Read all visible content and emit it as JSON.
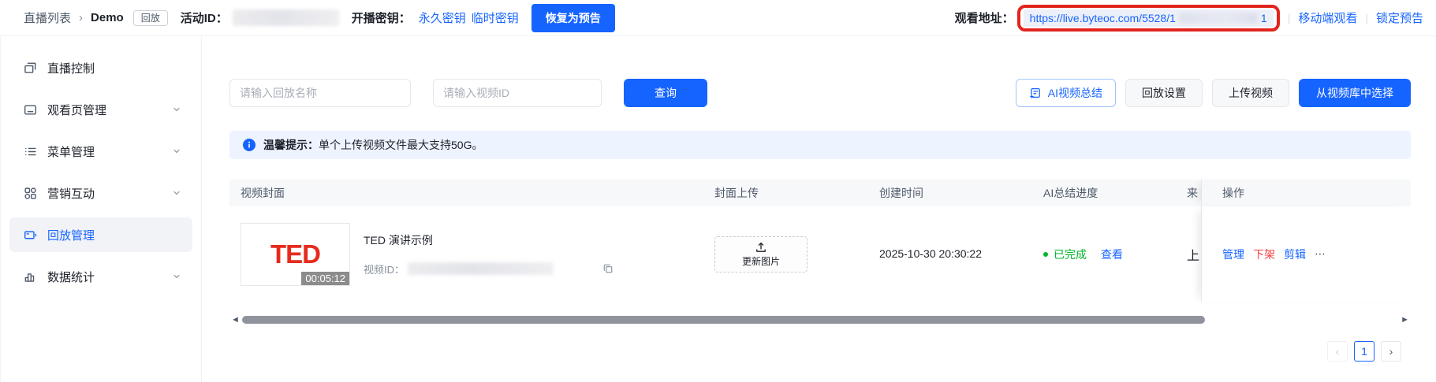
{
  "colors": {
    "primary": "#1664ff",
    "danger": "#f53f3f",
    "success": "#00b42a",
    "annotation_red": "#e2241d",
    "ted_red": "#e62b1e"
  },
  "topbar": {
    "breadcrumb_root": "直播列表",
    "breadcrumb_sep": "›",
    "breadcrumb_current": "Demo",
    "replay_badge": "回放",
    "activity_id_label": "活动ID：",
    "stream_key_label": "开播密钥：",
    "permanent_key_link": "永久密钥",
    "temp_key_link": "临时密钥",
    "restore_button": "恢复为预告",
    "watch_url_label": "观看地址：",
    "watch_url": "https://live.byteoc.com/5528/1",
    "watch_url_tail": "1",
    "divider": "|",
    "mobile_view_link": "移动端观看",
    "lock_preview_link": "锁定预告"
  },
  "sidebar": {
    "items": [
      {
        "label": "直播控制",
        "icon": "live-control-icon",
        "expandable": false,
        "active": false
      },
      {
        "label": "观看页管理",
        "icon": "watch-page-icon",
        "expandable": true,
        "active": false
      },
      {
        "label": "菜单管理",
        "icon": "menu-manage-icon",
        "expandable": true,
        "active": false
      },
      {
        "label": "营销互动",
        "icon": "marketing-icon",
        "expandable": true,
        "active": false
      },
      {
        "label": "回放管理",
        "icon": "replay-icon",
        "expandable": false,
        "active": true
      },
      {
        "label": "数据统计",
        "icon": "stats-icon",
        "expandable": true,
        "active": false
      }
    ]
  },
  "toolbar": {
    "name_input_placeholder": "请输入回放名称",
    "video_id_input_placeholder": "请输入视频ID",
    "query_button": "查询",
    "ai_summary_button": "AI视频总结",
    "replay_settings_button": "回放设置",
    "upload_video_button": "上传视频",
    "library_button": "从视频库中选择"
  },
  "notice": {
    "title": "温馨提示：",
    "text": "单个上传视频文件最大支持50G。"
  },
  "table": {
    "headers": {
      "cover": "视频封面",
      "cover_upload": "封面上传",
      "created_at": "创建时间",
      "ai_progress": "AI总结进度",
      "truncated": "来",
      "actions": "操作"
    },
    "row": {
      "thumb_text": "TED",
      "duration": "00:05:12",
      "title": "TED 演讲示例",
      "video_id_label": "视频ID：",
      "update_cover_button": "更新图片",
      "created_at": "2025-10-30 20:30:22",
      "ai_status": "已完成",
      "view_link": "查看",
      "truncated": "上",
      "actions": {
        "manage": "管理",
        "take_down": "下架",
        "clip": "剪辑",
        "more": "⋯"
      }
    }
  },
  "scrollbar": {
    "left_glyph": "◄",
    "right_glyph": "►"
  },
  "pagination": {
    "prev_glyph": "‹",
    "page": "1",
    "next_glyph": "›"
  }
}
